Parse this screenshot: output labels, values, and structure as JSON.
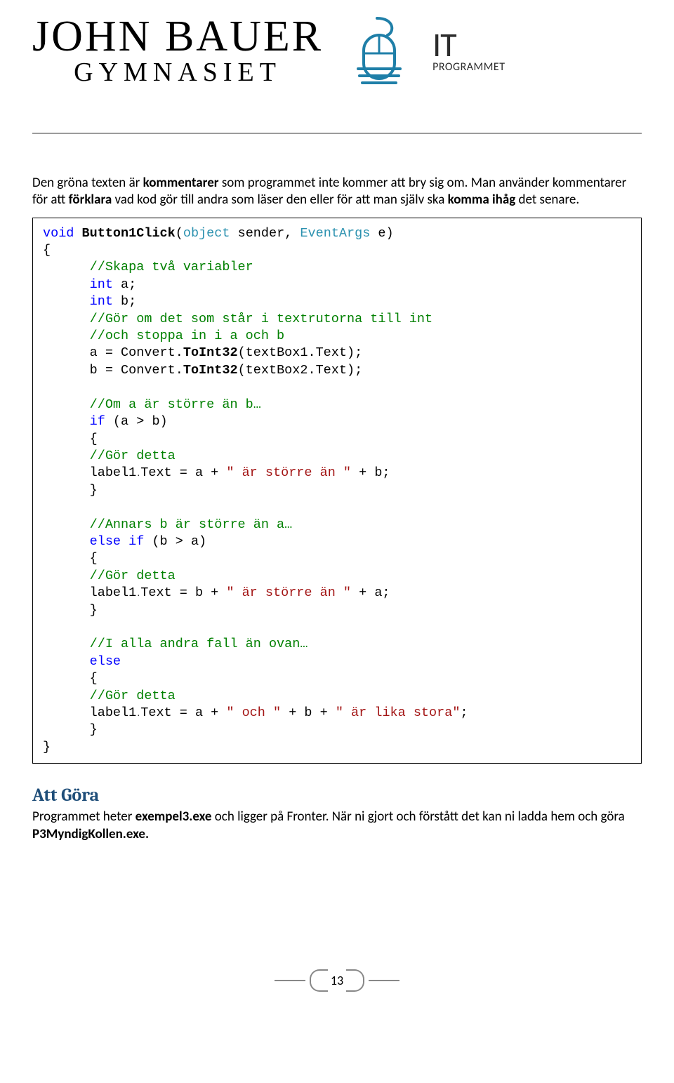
{
  "header": {
    "title_top": "JOHN BAUER",
    "title_bottom": "GYMNASIET",
    "it_label": "IT",
    "it_sub": "PROGRAMMET"
  },
  "intro": {
    "line1_pre": "Den gröna texten är ",
    "line1_b1": "kommentarer",
    "line1_mid": " som programmet inte kommer att bry sig om. Man använder kommentarer för att ",
    "line1_b2": "förklara",
    "line1_mid2": " vad kod gör till andra som läser den eller för att man själv ska ",
    "line1_b3": "komma ihåg",
    "line1_end": " det senare."
  },
  "code": {
    "l01a": "void",
    "l01b": " Button1Click",
    "l01c": "(",
    "l01d": "object",
    "l01e": " sender, ",
    "l01f": "EventArgs",
    "l01g": " e)",
    "l02": "{",
    "l03": "      //Skapa två variabler",
    "l04a": "      int",
    "l04b": " a;",
    "l05a": "      int",
    "l05b": " b;",
    "l06": "      //Gör om det som står i textrutorna till int",
    "l07": "      //och stoppa in i a och b",
    "l08a": "      a = Convert.",
    "l08b": "ToInt32",
    "l08c": "(textBox1.Text);",
    "l09a": "      b = Convert.",
    "l09b": "ToInt32",
    "l09c": "(textBox2.Text);",
    "l10": "",
    "l11": "      //Om a är större än b…",
    "l12a": "      if",
    "l12b": " (a > b)",
    "l13": "      {",
    "l14": "      //Gör detta",
    "l15a": "      label1",
    "l15dot": ".",
    "l15b": "Text = a + ",
    "l15c": "\" är större än \"",
    "l15d": " + b;",
    "l16": "      }",
    "l17": "",
    "l18": "      //Annars b är större än a…",
    "l19a": "      else if",
    "l19b": " (b > a)",
    "l20": "      {",
    "l21": "      //Gör detta",
    "l22a": "      label1",
    "l22dot": ".",
    "l22b": "Text = b + ",
    "l22c": "\" är större än \"",
    "l22d": " + a;",
    "l23": "      }",
    "l24": "",
    "l25": "      //I alla andra fall än ovan…",
    "l26": "      else",
    "l27": "      {",
    "l28": "      //Gör detta",
    "l29a": "      label1",
    "l29dot": ".",
    "l29b": "Text = a + ",
    "l29c": "\" och \"",
    "l29d": " + b + ",
    "l29e": "\" är lika stora\"",
    "l29f": ";",
    "l30": "      }",
    "l31": "}"
  },
  "todo": {
    "heading": "Att Göra",
    "p_pre": "Programmet heter ",
    "p_b1": "exempel3.exe",
    "p_mid": " och ligger på Fronter. När ni gjort och förstått det kan ni ladda hem och göra ",
    "p_b2": "P3MyndigKollen.exe.",
    "p_end": ""
  },
  "footer": {
    "page_number": "13"
  }
}
